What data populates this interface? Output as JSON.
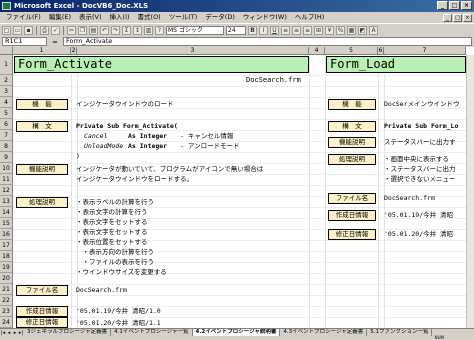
{
  "window": {
    "title": "Microsoft Excel - DocVB6_Doc.XLS",
    "buttons": [
      "_",
      "□",
      "×"
    ]
  },
  "menu": {
    "items": [
      "ファイル(F)",
      "編集(E)",
      "表示(V)",
      "挿入(I)",
      "書式(O)",
      "ツール(T)",
      "データ(D)",
      "ウィンドウ(W)",
      "ヘルプ(H)"
    ]
  },
  "toolbar": {
    "font_name": "MS ゴシック",
    "font_size": "24",
    "zoom": "100%"
  },
  "formula_bar": {
    "name_box": "R1C1",
    "fx": "=",
    "content": "Form_Activate"
  },
  "columns": [
    "1",
    "2",
    "3",
    "4",
    "5",
    "6",
    "7"
  ],
  "rows": [
    "1",
    "2",
    "3",
    "4",
    "5",
    "6",
    "7",
    "8",
    "9",
    "10",
    "11",
    "12",
    "13",
    "14",
    "15",
    "16",
    "17",
    "18",
    "19",
    "20",
    "21",
    "22",
    "23",
    "24",
    "25"
  ],
  "left": {
    "title": "Form_Activate",
    "filename": "DocSearch.frm",
    "labels": {
      "func": "機　能",
      "syntax": "構　文",
      "func_desc": "機能説明",
      "proc_desc": "処理説明",
      "file": "ファイル名",
      "created": "作成日情報",
      "modified": "修正日情報"
    },
    "func": "インジケータウインドウのロード",
    "syntax": {
      "head": "Private Sub Form_Activate(",
      "p1_name": "Cancel",
      "p1_type": "As Integer",
      "p1_desc": "- キャンセル情報",
      "p2_name": "UnloadMode",
      "p2_type": "As Integer",
      "p2_desc": "- アンロードモード",
      "close": ")"
    },
    "func_desc": [
      "インジケータが動いていて、プログラムがアイコンで無い場合は",
      "インジケータウインドウをロードする。"
    ],
    "proc_desc": [
      "・表示ラベルの計算を行う",
      "・表示文字の計算を行う",
      "・表示文字をセットする",
      "・表示文字をセットする",
      "・表示位置をセットする",
      "　・表示方向の計算を行う",
      "　・ファイルの表示を行う",
      "・ウインドウサイズを変更する"
    ],
    "file": "DocSearch.frm",
    "created": "'05.01.19/今井 清昭/1.0",
    "modified": "'05.01.20/今井 清昭/1.1"
  },
  "right": {
    "title": "Form_Load",
    "labels": {
      "func": "機　能",
      "syntax": "構　文",
      "func_desc": "機能説明",
      "proc_desc": "処理説明",
      "file": "ファイル名",
      "created": "作成日情報",
      "modified": "修正日情報"
    },
    "func": "DocSerメインウインドウ",
    "syntax": "Private Sub Form_Lo",
    "func_desc": "ステータスバーに出力す",
    "proc_desc": [
      "・画面中央に表示する",
      "・ステータスバーに出力",
      "・選択できないメニュー"
    ],
    "file": "DocSearch.frm",
    "created": "'05.01.19/今井 清昭",
    "modified": "'05.01.20/今井 清昭"
  },
  "sheet_tabs": [
    "3ジェネラルプロシージャ定義書",
    "4.1イベントプロシージャ一覧",
    "4.2イベントプロシージャ説明書",
    "4.3イベントプロシージャ定義書",
    "5.1ファンクション一覧"
  ],
  "active_tab_index": 2,
  "status": "NUM"
}
